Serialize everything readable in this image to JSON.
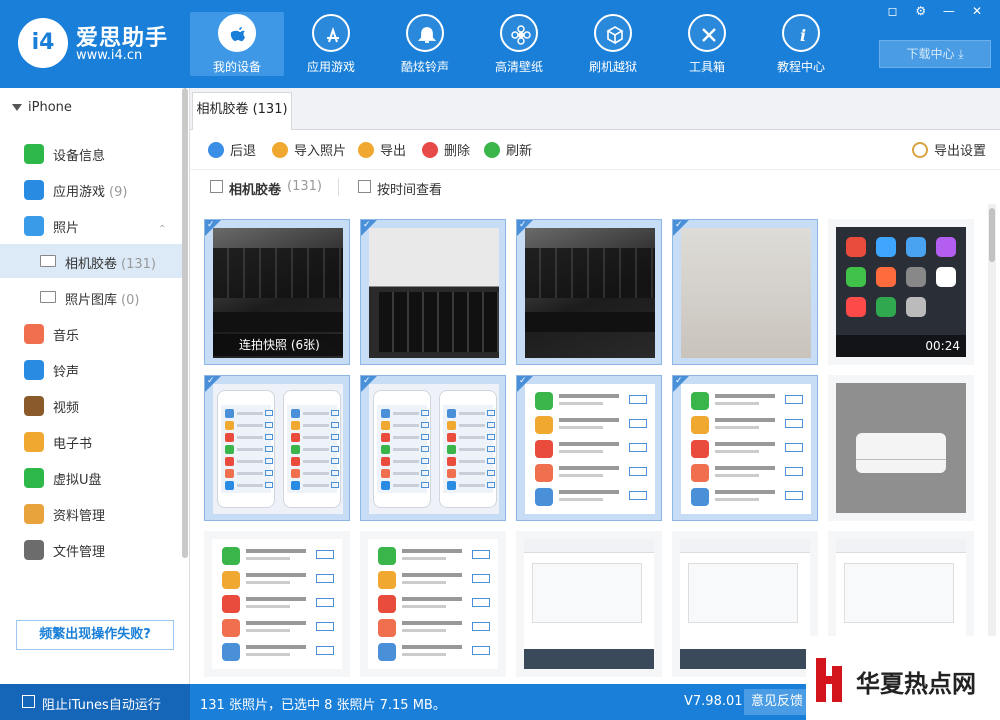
{
  "app": {
    "brand_name": "爱思助手",
    "brand_url": "www.i4.cn",
    "logo_text": "i4"
  },
  "nav": {
    "tabs": [
      {
        "label": "我的设备",
        "icon": "apple-icon",
        "active": true
      },
      {
        "label": "应用游戏",
        "icon": "app-store-icon",
        "active": false
      },
      {
        "label": "酷炫铃声",
        "icon": "bell-icon",
        "active": false
      },
      {
        "label": "高清壁纸",
        "icon": "flower-icon",
        "active": false
      },
      {
        "label": "刷机越狱",
        "icon": "box-icon",
        "active": false
      },
      {
        "label": "工具箱",
        "icon": "tools-icon",
        "active": false
      },
      {
        "label": "教程中心",
        "icon": "info-icon",
        "active": false
      }
    ],
    "download_label": "下载中心 ⤓"
  },
  "window_controls": [
    "shirt-icon",
    "gear-icon",
    "minimize-icon",
    "close-icon"
  ],
  "sidebar": {
    "device": "iPhone",
    "items": [
      {
        "label": "设备信息",
        "count": "",
        "icon": "info-icon",
        "color": "#2fb84a"
      },
      {
        "label": "应用游戏",
        "count": "(9)",
        "icon": "app-store-icon",
        "color": "#2a8be3"
      },
      {
        "label": "照片",
        "count": "",
        "icon": "photo-icon",
        "color": "#3a9be8"
      },
      {
        "label": "相机胶卷",
        "count": "(131)",
        "icon": "folder-icon",
        "color": "#888888",
        "sub": true,
        "selected": true
      },
      {
        "label": "照片图库",
        "count": "(0)",
        "icon": "folder-icon",
        "color": "#888888",
        "sub": true
      },
      {
        "label": "音乐",
        "count": "",
        "icon": "music-icon",
        "color": "#f06f4e"
      },
      {
        "label": "铃声",
        "count": "",
        "icon": "bell-icon",
        "color": "#2a8be3"
      },
      {
        "label": "视频",
        "count": "",
        "icon": "video-icon",
        "color": "#8a5a2b"
      },
      {
        "label": "电子书",
        "count": "",
        "icon": "book-icon",
        "color": "#f0a830"
      },
      {
        "label": "虚拟U盘",
        "count": "",
        "icon": "usb-icon",
        "color": "#2fb84a"
      },
      {
        "label": "资料管理",
        "count": "",
        "icon": "contacts-icon",
        "color": "#e8a33c"
      },
      {
        "label": "文件管理",
        "count": "",
        "icon": "file-icon",
        "color": "#6c6c6c"
      }
    ],
    "help_label": "频繁出现操作失败?"
  },
  "main": {
    "tab_label": "相机胶卷 (131)",
    "toolbar": [
      {
        "label": "后退",
        "icon": "back-icon",
        "color": "#3a8ee6"
      },
      {
        "label": "导入照片",
        "icon": "import-icon",
        "color": "#f0a830"
      },
      {
        "label": "导出",
        "icon": "export-icon",
        "color": "#f0a830"
      },
      {
        "label": "删除",
        "icon": "delete-icon",
        "color": "#e84a4a"
      },
      {
        "label": "刷新",
        "icon": "refresh-icon",
        "color": "#3ab54a"
      }
    ],
    "export_settings_label": "导出设置",
    "filter": {
      "album_label": "相机胶卷",
      "album_count": "(131)",
      "by_time_label": "按时间查看"
    },
    "thumbnails": [
      {
        "kind": "keyboard",
        "selected": true,
        "caption": "连拍快照 (6张)"
      },
      {
        "kind": "keyboard-light",
        "selected": true,
        "caption": ""
      },
      {
        "kind": "keyboard",
        "selected": true,
        "caption": ""
      },
      {
        "kind": "blank",
        "selected": true,
        "caption": ""
      },
      {
        "kind": "homescreen",
        "selected": false,
        "caption": "00:24"
      },
      {
        "kind": "twophones",
        "selected": true,
        "caption": ""
      },
      {
        "kind": "twophones",
        "selected": true,
        "caption": ""
      },
      {
        "kind": "applist",
        "selected": true,
        "caption": ""
      },
      {
        "kind": "applist",
        "selected": true,
        "caption": ""
      },
      {
        "kind": "dialog",
        "selected": false,
        "caption": ""
      },
      {
        "kind": "applist",
        "selected": false,
        "caption": ""
      },
      {
        "kind": "applist",
        "selected": false,
        "caption": ""
      },
      {
        "kind": "desktop",
        "selected": false,
        "caption": ""
      },
      {
        "kind": "desktop",
        "selected": false,
        "caption": ""
      },
      {
        "kind": "desktop",
        "selected": false,
        "caption": ""
      }
    ]
  },
  "statusbar": {
    "itunes_label": "阻止iTunes自动运行",
    "status_text": "131 张照片，已选中 8 张照片 7.15 MB。",
    "version": "V7.98.01",
    "feedback_label": "意见反馈"
  },
  "watermark": {
    "text": "华夏热点网"
  }
}
